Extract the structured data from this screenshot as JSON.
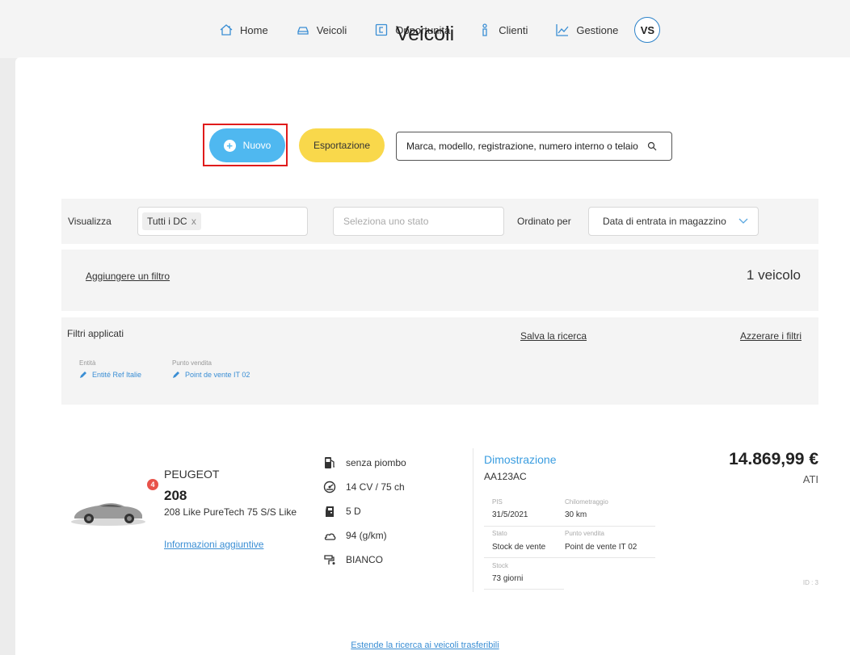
{
  "nav": {
    "items": [
      {
        "label": "Home",
        "icon": "home-icon"
      },
      {
        "label": "Veicoli",
        "icon": "car-icon"
      },
      {
        "label": "Opportunità",
        "icon": "wallet-icon"
      },
      {
        "label": "Clienti",
        "icon": "person-icon"
      },
      {
        "label": "Gestione",
        "icon": "chart-icon"
      }
    ],
    "avatar": "VS"
  },
  "page": {
    "title": "Veicoli"
  },
  "actions": {
    "new_label": "Nuovo",
    "export_label": "Esportazione",
    "search_value": "Marca, modello, registrazione, numero interno o telaio"
  },
  "filters": {
    "view_label": "Visualizza",
    "view_chip": "Tutti i DC",
    "view_chip_remove": "x",
    "status_placeholder": "Seleziona uno stato",
    "sort_label": "Ordinato per",
    "sort_value": "Data di entrata in magazzino",
    "add_filter": "Aggiungere un filtro",
    "count": "1 veicolo",
    "applied_title": "Filtri applicati",
    "save_search": "Salva la ricerca",
    "reset_filters": "Azzerare i filtri",
    "applied": [
      {
        "key": "Entità",
        "value": "Entité Ref Italie"
      },
      {
        "key": "Punto vendita",
        "value": "Point de vente IT 02"
      }
    ]
  },
  "vehicle": {
    "badge": "4",
    "brand": "PEUGEOT",
    "model": "208",
    "version": "208 Like PureTech 75 S/S Like",
    "more_info": "Informazioni aggiuntive",
    "specs": [
      {
        "icon": "fuel-icon",
        "text": "senza piombo"
      },
      {
        "icon": "engine-icon",
        "text": "14 CV / 75 ch"
      },
      {
        "icon": "door-icon",
        "text": "5 D"
      },
      {
        "icon": "cloud-icon",
        "text": "94 (g/km)"
      },
      {
        "icon": "paint-icon",
        "text": "BIANCO"
      }
    ],
    "status": "Dimostrazione",
    "plate": "AA123AC",
    "details": {
      "pis_label": "PIS",
      "pis_value": "31/5/2021",
      "km_label": "Chilometraggio",
      "km_value": "30 km",
      "stato_label": "Stato",
      "stato_value": "Stock de vente",
      "pv_label": "Punto vendita",
      "pv_value": "Point de vente IT 02",
      "stock_label": "Stock",
      "stock_value": "73 giorni"
    },
    "price": "14.869,99 €",
    "price_suffix": "ATI",
    "id": "ID : 3"
  },
  "footer": {
    "extend_link": "Estende la ricerca ai veicoli trasferibili"
  },
  "colors": {
    "primary_blue": "#4fb8f0",
    "export_yellow": "#f9d84b",
    "link_blue": "#3a8ed4",
    "highlight_red": "#e01b1b"
  }
}
